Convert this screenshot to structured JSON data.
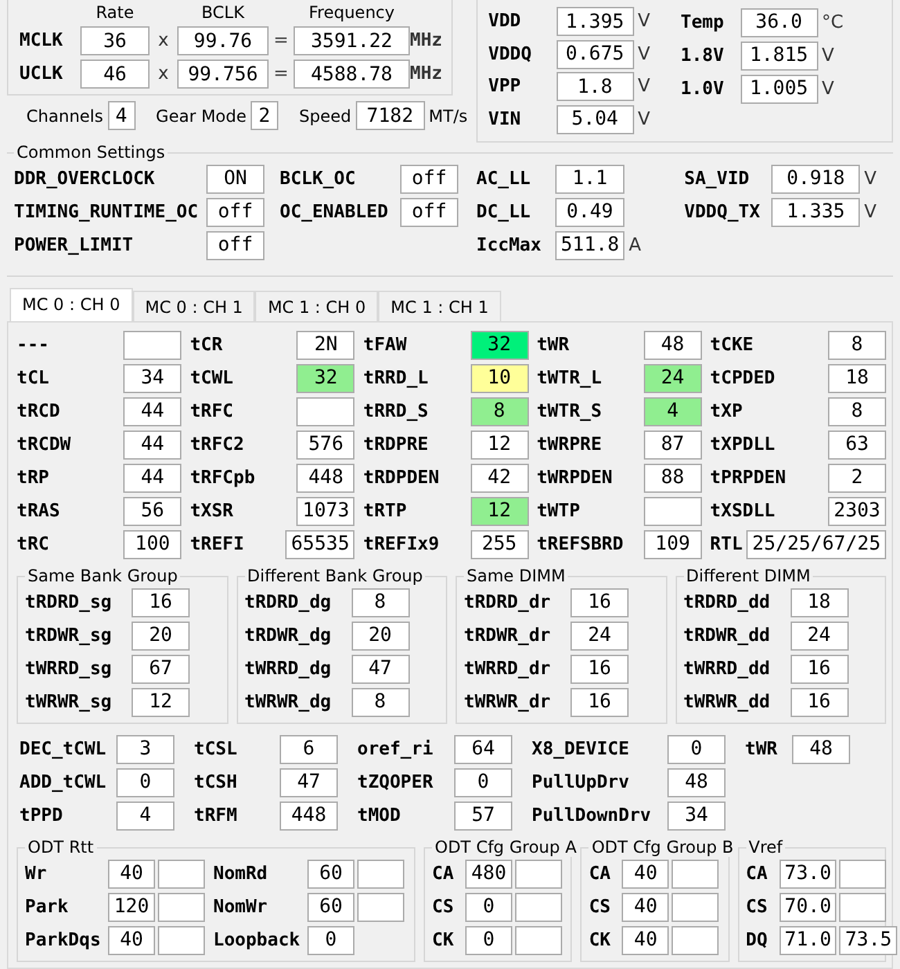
{
  "frequency": {
    "headers": [
      "Rate",
      "BCLK",
      "Frequency"
    ],
    "rows": [
      {
        "label": "MCLK",
        "rate": "36",
        "times": "x",
        "bclk": "99.76",
        "equals": "=",
        "frequency": "3591.22",
        "unit": "MHz"
      },
      {
        "label": "UCLK",
        "rate": "46",
        "times": "x",
        "bclk": "99.756",
        "equals": "=",
        "frequency": "4588.78",
        "unit": "MHz"
      }
    ]
  },
  "memory_info": [
    {
      "label": "Channels",
      "value": "4"
    },
    {
      "label": "Gear Mode",
      "value": "2"
    },
    {
      "label": "Speed",
      "value": "7182",
      "unit": "MT/s"
    }
  ],
  "voltages": {
    "columns": [
      [
        {
          "label": "VDD",
          "value": "1.395",
          "unit": "V"
        },
        {
          "label": "VDDQ",
          "value": "0.675",
          "unit": "V"
        },
        {
          "label": "VPP",
          "value": "1.8",
          "unit": "V"
        },
        {
          "label": "VIN",
          "value": "5.04",
          "unit": "V"
        }
      ],
      [
        {
          "label": "Temp",
          "value": "36.0",
          "unit": "°C"
        },
        {
          "label": "1.8V",
          "value": "1.815",
          "unit": "V"
        },
        {
          "label": "1.0V",
          "value": "1.005",
          "unit": "V"
        }
      ]
    ]
  },
  "common_settings": {
    "title": "Common Settings",
    "columns": [
      [
        {
          "label": "DDR_OVERCLOCK",
          "value": "ON"
        },
        {
          "label": "TIMING_RUNTIME_OC",
          "value": "off"
        },
        {
          "label": "POWER_LIMIT",
          "value": "off"
        }
      ],
      [
        {
          "label": "BCLK_OC",
          "value": "off"
        },
        {
          "label": "OC_ENABLED",
          "value": "off"
        }
      ],
      [
        {
          "label": "AC_LL",
          "value": "1.1"
        },
        {
          "label": "DC_LL",
          "value": "0.49"
        },
        {
          "label": "IccMax",
          "value": "511.8",
          "unit": "A"
        }
      ],
      [
        {
          "label": "SA_VID",
          "value": "0.918",
          "unit": "V"
        },
        {
          "label": "VDDQ_TX",
          "value": "1.335",
          "unit": "V"
        }
      ]
    ]
  },
  "tabs": [
    {
      "label": "MC 0 : CH 0",
      "selected": true
    },
    {
      "label": "MC 0 : CH 1",
      "selected": false
    },
    {
      "label": "MC 1 : CH 0",
      "selected": false
    },
    {
      "label": "MC 1 : CH 1",
      "selected": false
    }
  ],
  "timings": {
    "columns": [
      [
        {
          "label": "---"
        },
        {
          "label": "tCL",
          "value": "34"
        },
        {
          "label": "tRCD",
          "value": "44"
        },
        {
          "label": "tRCDW",
          "value": "44"
        },
        {
          "label": "tRP",
          "value": "44"
        },
        {
          "label": "tRAS",
          "value": "56"
        },
        {
          "label": "tRC",
          "value": "100"
        }
      ],
      [
        {
          "label": "tCR",
          "value": "2N"
        },
        {
          "label": "tCWL",
          "value": "32",
          "color": "#90ee90"
        },
        {
          "label": "tRFC"
        },
        {
          "label": "tRFC2",
          "value": "576"
        },
        {
          "label": "tRFCpb",
          "value": "448"
        },
        {
          "label": "tXSR",
          "value": "1073"
        },
        {
          "label": "tREFI",
          "value": "65535"
        }
      ],
      [
        {
          "label": "tFAW",
          "value": "32",
          "color": "#00f07a"
        },
        {
          "label": "tRRD_L",
          "value": "10",
          "color": "#ffff99"
        },
        {
          "label": "tRRD_S",
          "value": "8",
          "color": "#90ee90"
        },
        {
          "label": "tRDPRE",
          "value": "12"
        },
        {
          "label": "tRDPDEN",
          "value": "42"
        },
        {
          "label": "tRTP",
          "value": "12",
          "color": "#90ee90"
        },
        {
          "label": "tREFIx9",
          "value": "255"
        }
      ],
      [
        {
          "label": "tWR",
          "value": "48"
        },
        {
          "label": "tWTR_L",
          "value": "24",
          "color": "#90ee90"
        },
        {
          "label": "tWTR_S",
          "value": "4",
          "color": "#90ee90"
        },
        {
          "label": "tWRPRE",
          "value": "87"
        },
        {
          "label": "tWRPDEN",
          "value": "88"
        },
        {
          "label": "tWTP"
        },
        {
          "label": "tREFSBRD",
          "value": "109"
        }
      ],
      [
        {
          "label": "tCKE",
          "value": "8"
        },
        {
          "label": "tCPDED",
          "value": "18"
        },
        {
          "label": "tXP",
          "value": "8"
        },
        {
          "label": "tXPDLL",
          "value": "63"
        },
        {
          "label": "tPRPDEN",
          "value": "2"
        },
        {
          "label": "tXSDLL",
          "value": "2303"
        },
        {
          "label": "RTL",
          "value": "25/25/67/25"
        }
      ]
    ]
  },
  "turnaround_groups": [
    {
      "title": "Same Bank Group",
      "items": [
        {
          "label": "tRDRD_sg",
          "value": "16"
        },
        {
          "label": "tRDWR_sg",
          "value": "20"
        },
        {
          "label": "tWRRD_sg",
          "value": "67"
        },
        {
          "label": "tWRWR_sg",
          "value": "12"
        }
      ]
    },
    {
      "title": "Different Bank Group",
      "items": [
        {
          "label": "tRDRD_dg",
          "value": "8"
        },
        {
          "label": "tRDWR_dg",
          "value": "20"
        },
        {
          "label": "tWRRD_dg",
          "value": "47"
        },
        {
          "label": "tWRWR_dg",
          "value": "8"
        }
      ]
    },
    {
      "title": "Same DIMM",
      "items": [
        {
          "label": "tRDRD_dr",
          "value": "16"
        },
        {
          "label": "tRDWR_dr",
          "value": "24"
        },
        {
          "label": "tWRRD_dr",
          "value": "16"
        },
        {
          "label": "tWRWR_dr",
          "value": "16"
        }
      ]
    },
    {
      "title": "Different DIMM",
      "items": [
        {
          "label": "tRDRD_dd",
          "value": "18"
        },
        {
          "label": "tRDWR_dd",
          "value": "24"
        },
        {
          "label": "tWRRD_dd",
          "value": "16"
        },
        {
          "label": "tWRWR_dd",
          "value": "16"
        }
      ]
    }
  ],
  "misc": {
    "columns": [
      [
        {
          "label": "DEC_tCWL",
          "value": "3"
        },
        {
          "label": "ADD_tCWL",
          "value": "0"
        },
        {
          "label": "tPPD",
          "value": "4"
        }
      ],
      [
        {
          "label": "tCSL",
          "value": "6"
        },
        {
          "label": "tCSH",
          "value": "47"
        },
        {
          "label": "tRFM",
          "value": "448"
        }
      ],
      [
        {
          "label": "oref_ri",
          "value": "64"
        },
        {
          "label": "tZQOPER",
          "value": "0"
        },
        {
          "label": "tMOD",
          "value": "57"
        }
      ],
      [
        {
          "label": "X8_DEVICE",
          "value": "0"
        },
        {
          "label": "PullUpDrv",
          "value": "48"
        },
        {
          "label": "PullDownDrv",
          "value": "34"
        }
      ],
      [
        {
          "label": "tWR",
          "value": "48"
        }
      ]
    ]
  },
  "odt_rtt": {
    "title": "ODT Rtt",
    "columns": [
      [
        {
          "label": "Wr",
          "values": [
            "40"
          ],
          "extra_box": true
        },
        {
          "label": "Park",
          "values": [
            "120"
          ],
          "extra_box": true
        },
        {
          "label": "ParkDqs",
          "values": [
            "40"
          ],
          "extra_box": true
        }
      ],
      [
        {
          "label": "NomRd",
          "values": [
            "60"
          ],
          "extra_box": true
        },
        {
          "label": "NomWr",
          "values": [
            "60"
          ],
          "extra_box": true
        },
        {
          "label": "Loopback",
          "values": [
            "0"
          ],
          "extra_box": false
        }
      ]
    ]
  },
  "odt_groups": [
    {
      "title": "ODT Cfg Group A",
      "items": [
        {
          "label": "CA",
          "values": [
            "480"
          ],
          "extra_box": true
        },
        {
          "label": "CS",
          "values": [
            "0"
          ],
          "extra_box": true
        },
        {
          "label": "CK",
          "values": [
            "0"
          ],
          "extra_box": true
        }
      ]
    },
    {
      "title": "ODT Cfg Group B",
      "items": [
        {
          "label": "CA",
          "values": [
            "40"
          ],
          "extra_box": true
        },
        {
          "label": "CS",
          "values": [
            "40"
          ],
          "extra_box": true
        },
        {
          "label": "CK",
          "values": [
            "40"
          ],
          "extra_box": true
        }
      ]
    },
    {
      "title": "Vref",
      "items": [
        {
          "label": "CA",
          "values": [
            "73.0"
          ],
          "extra_box": true
        },
        {
          "label": "CS",
          "values": [
            "70.0"
          ],
          "extra_box": true
        },
        {
          "label": "DQ",
          "values": [
            "71.0",
            "73.5"
          ],
          "extra_box": false
        }
      ]
    }
  ]
}
